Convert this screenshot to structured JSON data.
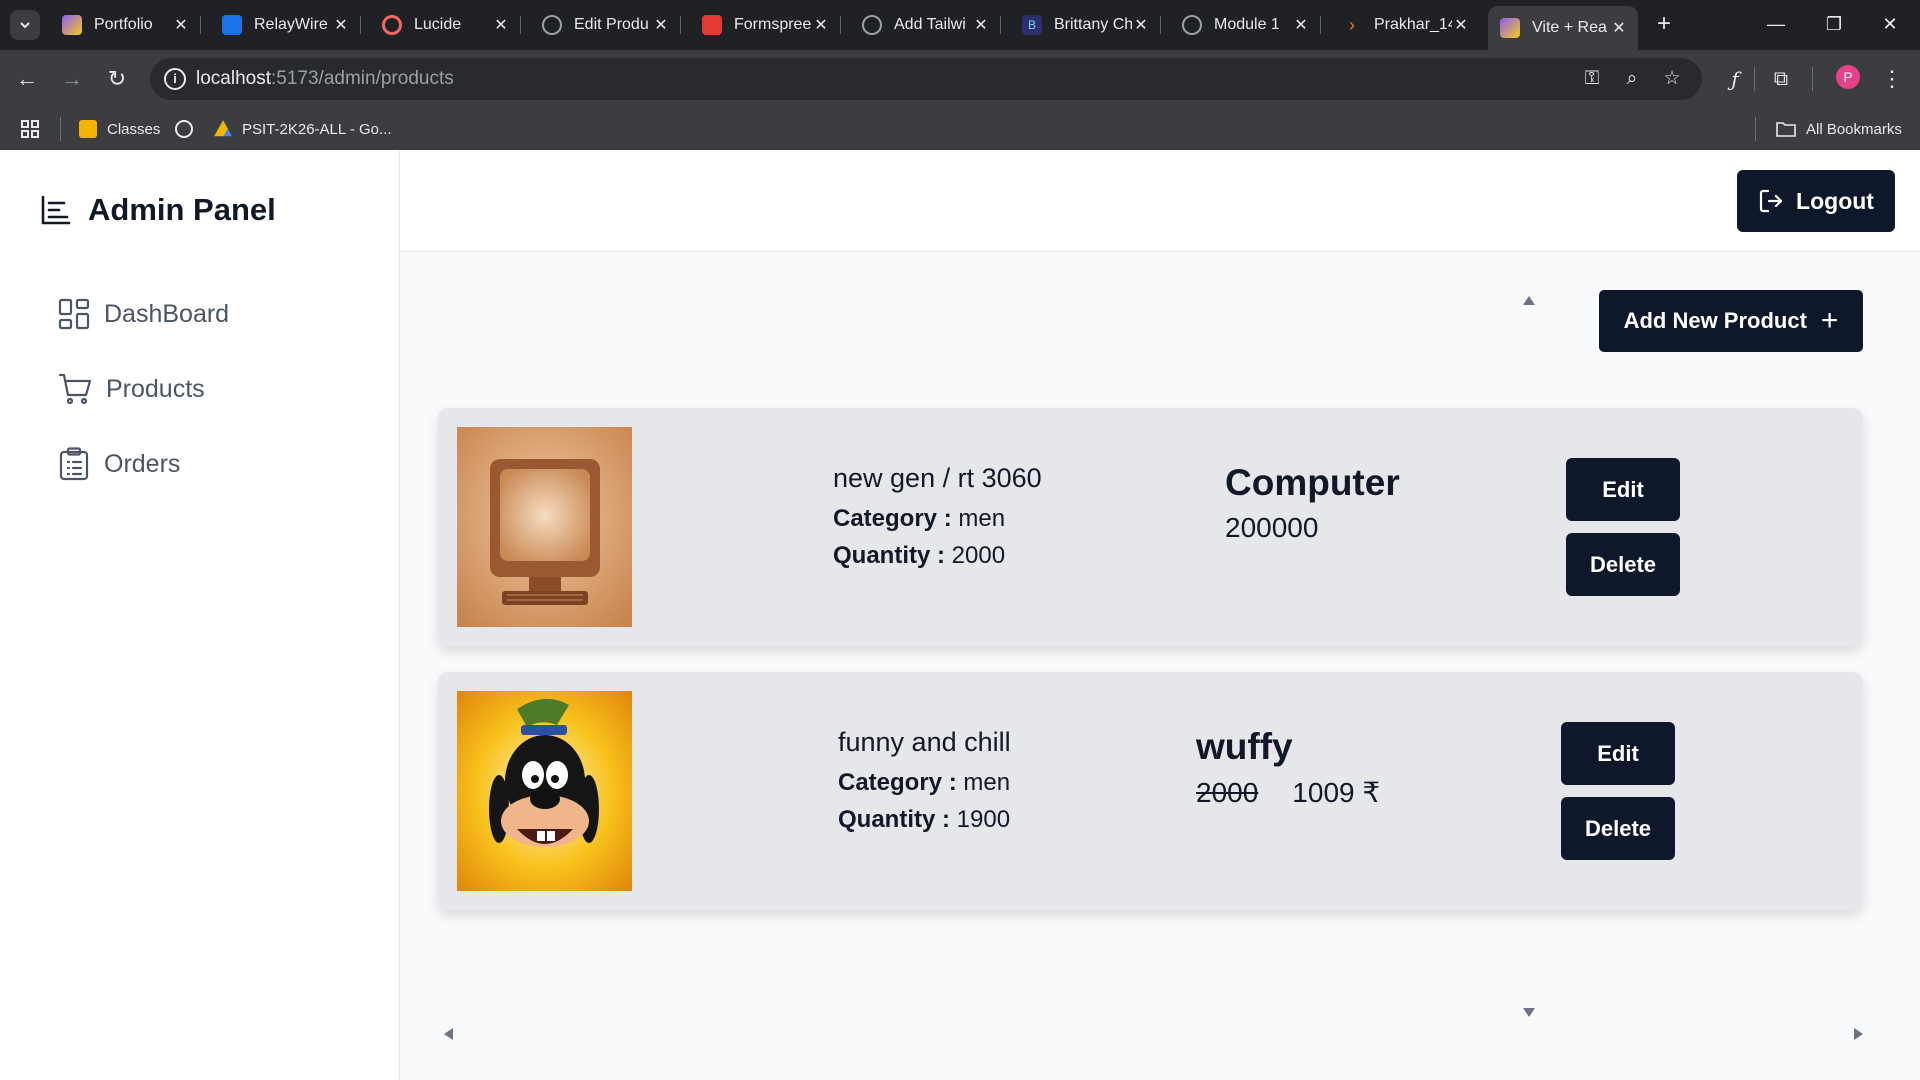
{
  "browser": {
    "tabs": [
      {
        "title": "Portfolio",
        "color": "#8b5cf6"
      },
      {
        "title": "RelayWire",
        "color": "#1a73e8"
      },
      {
        "title": "Lucide",
        "color": "#f56565"
      },
      {
        "title": "Edit Produ",
        "color": "#9aa0a6"
      },
      {
        "title": "Formspree",
        "color": "#e53935"
      },
      {
        "title": "Add Tailwi",
        "color": "#9aa0a6"
      },
      {
        "title": "Brittany Ch",
        "color": "#2b2f6e"
      },
      {
        "title": "Module 1",
        "color": "#9aa0a6"
      },
      {
        "title": "Prakhar_14",
        "color": "#f97316"
      },
      {
        "title": "Vite + Rea",
        "color": "#8b5cf6"
      }
    ],
    "url_host": "localhost",
    "url_path": ":5173/admin/products",
    "avatar_letter": "P",
    "bookmarks": {
      "classes": "Classes",
      "psit": "PSIT-2K26-ALL - Go...",
      "all": "All Bookmarks"
    }
  },
  "app": {
    "brand": "Admin Panel",
    "menu": {
      "dashboard": "DashBoard",
      "products": "Products",
      "orders": "Orders"
    },
    "logout_label": "Logout",
    "add_product_label": "Add New Product",
    "products": [
      {
        "name": "new gen / rt 3060",
        "category_label": "Category :",
        "category": "men",
        "quantity_label": "Quantity :",
        "quantity": "2000",
        "title": "Computer",
        "price": "200000",
        "edit_label": "Edit",
        "delete_label": "Delete"
      },
      {
        "name": "funny and chill",
        "category_label": "Category :",
        "category": "men",
        "quantity_label": "Quantity :",
        "quantity": "1900",
        "title": "wuffy",
        "old_price": "2000",
        "price": "1009 ₹",
        "edit_label": "Edit",
        "delete_label": "Delete"
      }
    ]
  }
}
